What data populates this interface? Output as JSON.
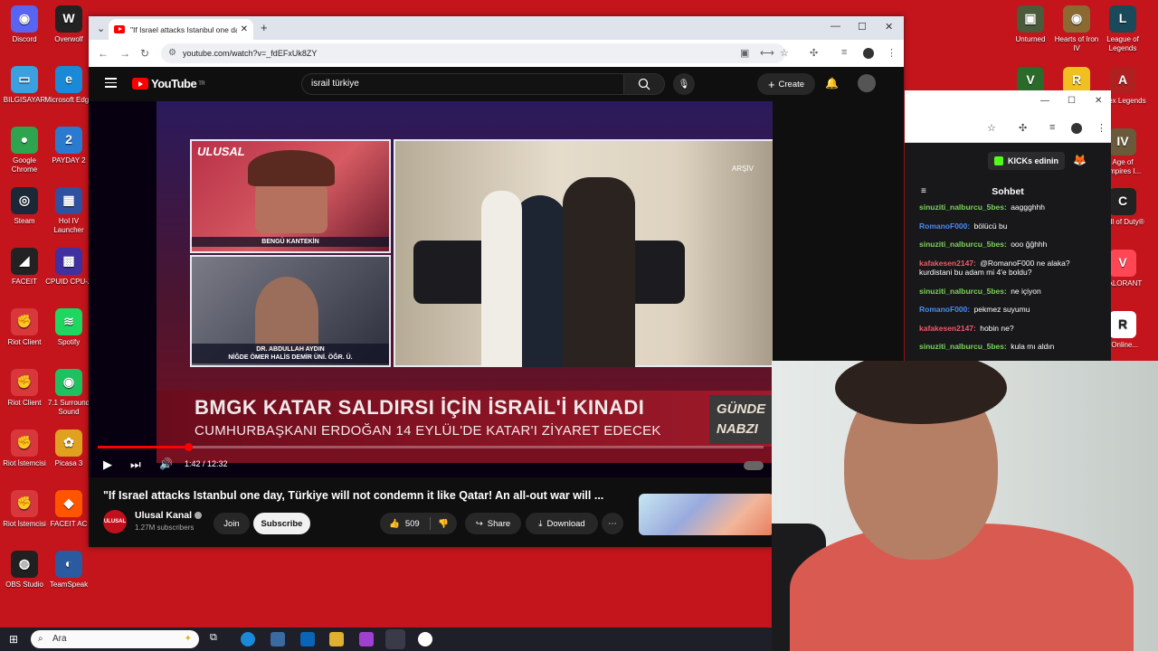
{
  "desktop": {
    "left_icons": [
      {
        "label": "Discord",
        "color": "#5865f2",
        "glyph": "◉",
        "icon": "discord-icon"
      },
      {
        "label": "Overwolf",
        "color": "#222",
        "glyph": "W",
        "icon": "overwolf-icon"
      },
      {
        "label": "BILGISAYAR",
        "color": "#3aa0e0",
        "glyph": "▭",
        "icon": "computer-icon"
      },
      {
        "label": "Microsoft Edge",
        "color": "#1a8ad8",
        "glyph": "e",
        "icon": "edge-icon"
      },
      {
        "label": "Google Chrome",
        "color": "#2ea44f",
        "glyph": "●",
        "icon": "chrome-icon"
      },
      {
        "label": "PAYDAY 2",
        "color": "#2a7ad0",
        "glyph": "2",
        "icon": "payday-icon"
      },
      {
        "label": "Steam",
        "color": "#1b2838",
        "glyph": "◎",
        "icon": "steam-icon"
      },
      {
        "label": "HoI IV Launcher",
        "color": "#3050a0",
        "glyph": "▦",
        "icon": "hoi-launcher-icon"
      },
      {
        "label": "FACEIT",
        "color": "#222",
        "glyph": "◢",
        "icon": "faceit-icon"
      },
      {
        "label": "CPUID CPU-Z",
        "color": "#4030a0",
        "glyph": "▩",
        "icon": "cpuz-icon"
      },
      {
        "label": "Riot Client",
        "color": "#d8383c",
        "glyph": "✊",
        "icon": "riot-client-icon"
      },
      {
        "label": "Spotify",
        "color": "#1ed760",
        "glyph": "≋",
        "icon": "spotify-icon"
      },
      {
        "label": "Riot Client",
        "color": "#d8383c",
        "glyph": "✊",
        "icon": "riot-client-icon"
      },
      {
        "label": "7.1 Surround Sound",
        "color": "#20c060",
        "glyph": "◉",
        "icon": "surround-sound-icon"
      },
      {
        "label": "Riot İstemcisi",
        "color": "#d8383c",
        "glyph": "✊",
        "icon": "riot-istemcisi-icon"
      },
      {
        "label": "Picasa 3",
        "color": "#e0a020",
        "glyph": "✿",
        "icon": "picasa-icon"
      },
      {
        "label": "Riot İstemcisi",
        "color": "#d8383c",
        "glyph": "✊",
        "icon": "riot-istemcisi-icon"
      },
      {
        "label": "FACEIT AC",
        "color": "#ff5500",
        "glyph": "◆",
        "icon": "faceit-ac-icon"
      },
      {
        "label": "OBS Studio",
        "color": "#202020",
        "glyph": "◍",
        "icon": "obs-icon"
      },
      {
        "label": "TeamSpeak",
        "color": "#2a5aa0",
        "glyph": "◐",
        "icon": "teamspeak-icon"
      }
    ],
    "right_icons": [
      {
        "label": "Unturned",
        "color": "#4a5a3a",
        "glyph": "▣",
        "icon": "unturned-icon"
      },
      {
        "label": "Hearts of Iron IV",
        "color": "#8a6a30",
        "glyph": "◉",
        "icon": "hoi4-icon"
      },
      {
        "label": "League of Legends",
        "color": "#1a4a5a",
        "glyph": "L",
        "icon": "lol-icon"
      },
      {
        "label": "",
        "color": "#2a6a2a",
        "glyph": "V",
        "icon": "gta-icon"
      },
      {
        "label": "",
        "color": "#f0c020",
        "glyph": "R",
        "icon": "rockstar-icon"
      },
      {
        "label": "Apex Legends",
        "color": "#b02020",
        "glyph": "A",
        "icon": "apex-icon"
      },
      {
        "label": "Age of Empires I...",
        "color": "#6a5a3a",
        "glyph": "IV",
        "icon": "aoe-icon"
      },
      {
        "label": "Call of Duty®",
        "color": "#222",
        "glyph": "C",
        "icon": "cod-icon"
      },
      {
        "label": "VALORANT",
        "color": "#ff4655",
        "glyph": "V",
        "icon": "valorant-icon"
      },
      {
        "label": "eOnline...",
        "color": "#ffffff",
        "glyph": "R",
        "icon": "rage-online-icon"
      }
    ]
  },
  "browser": {
    "tab_title": "\"If Israel attacks Istanbul one da",
    "url": "youtube.com/watch?v=_fdEFxUk8ZY"
  },
  "youtube": {
    "logo": "YouTube",
    "region": "TR",
    "search_query": "israil türkiye",
    "create_label": "Create",
    "video": {
      "panel_logo": "ULUSAL",
      "anchor_name": "BENGÜ KANTEKİN",
      "guest_name": "DR. ABDULLAH AYDIN",
      "guest_affiliation": "NİĞDE ÖMER HALİS DEMİR ÜNİ. ÖĞR. Ü.",
      "archive_label": "ARŞİV",
      "headline": "BMGK KATAR SALDIRSI İÇİN İSRAİL'İ KINADI",
      "subheadline": "CUMHURBAŞKANI ERDOĞAN 14 EYLÜL'DE KATAR'I ZİYARET EDECEK",
      "corner_tag_1": "GÜNDE",
      "corner_tag_2": "NABZI",
      "time": "1:42 / 12:32",
      "progress_fraction": 0.136
    },
    "title": "\"If Israel attacks Istanbul one day, Türkiye will not condemn it like Qatar! An all-out war will ...",
    "channel_name": "Ulusal Kanal",
    "channel_avatar_text": "ULUSAL",
    "subscribers": "1.27M subscribers",
    "join_label": "Join",
    "subscribe_label": "Subscribe",
    "likes": "509",
    "share_label": "Share",
    "download_label": "Download"
  },
  "chat": {
    "kick_button": "KICKs edinin",
    "title": "Sohbet",
    "messages": [
      {
        "user": "sinuziti_nalburcu_5bes",
        "text": "aaggghhh",
        "color": "#7cd35a"
      },
      {
        "user": "RomanoF000",
        "text": "bölücü bu",
        "color": "#4a8cf0"
      },
      {
        "user": "sinuziti_nalburcu_5bes",
        "text": "ooo ğğhhh",
        "color": "#7cd35a"
      },
      {
        "user": "kafakesen2147",
        "text": "@RomanoF000 ne alaka? kurdistani bu adam mi 4'e boldu?",
        "color": "#f05a6a"
      },
      {
        "user": "sinuziti_nalburcu_5bes",
        "text": "ne içiyon",
        "color": "#7cd35a"
      },
      {
        "user": "RomanoF000",
        "text": "pekmez suyumu",
        "color": "#4a8cf0"
      },
      {
        "user": "kafakesen2147",
        "text": "hobin ne?",
        "color": "#f05a6a"
      },
      {
        "user": "sinuziti_nalburcu_5bes",
        "text": "kula mı aldın",
        "color": "#7cd35a"
      }
    ]
  },
  "taskbar": {
    "search_placeholder": "Ara"
  }
}
